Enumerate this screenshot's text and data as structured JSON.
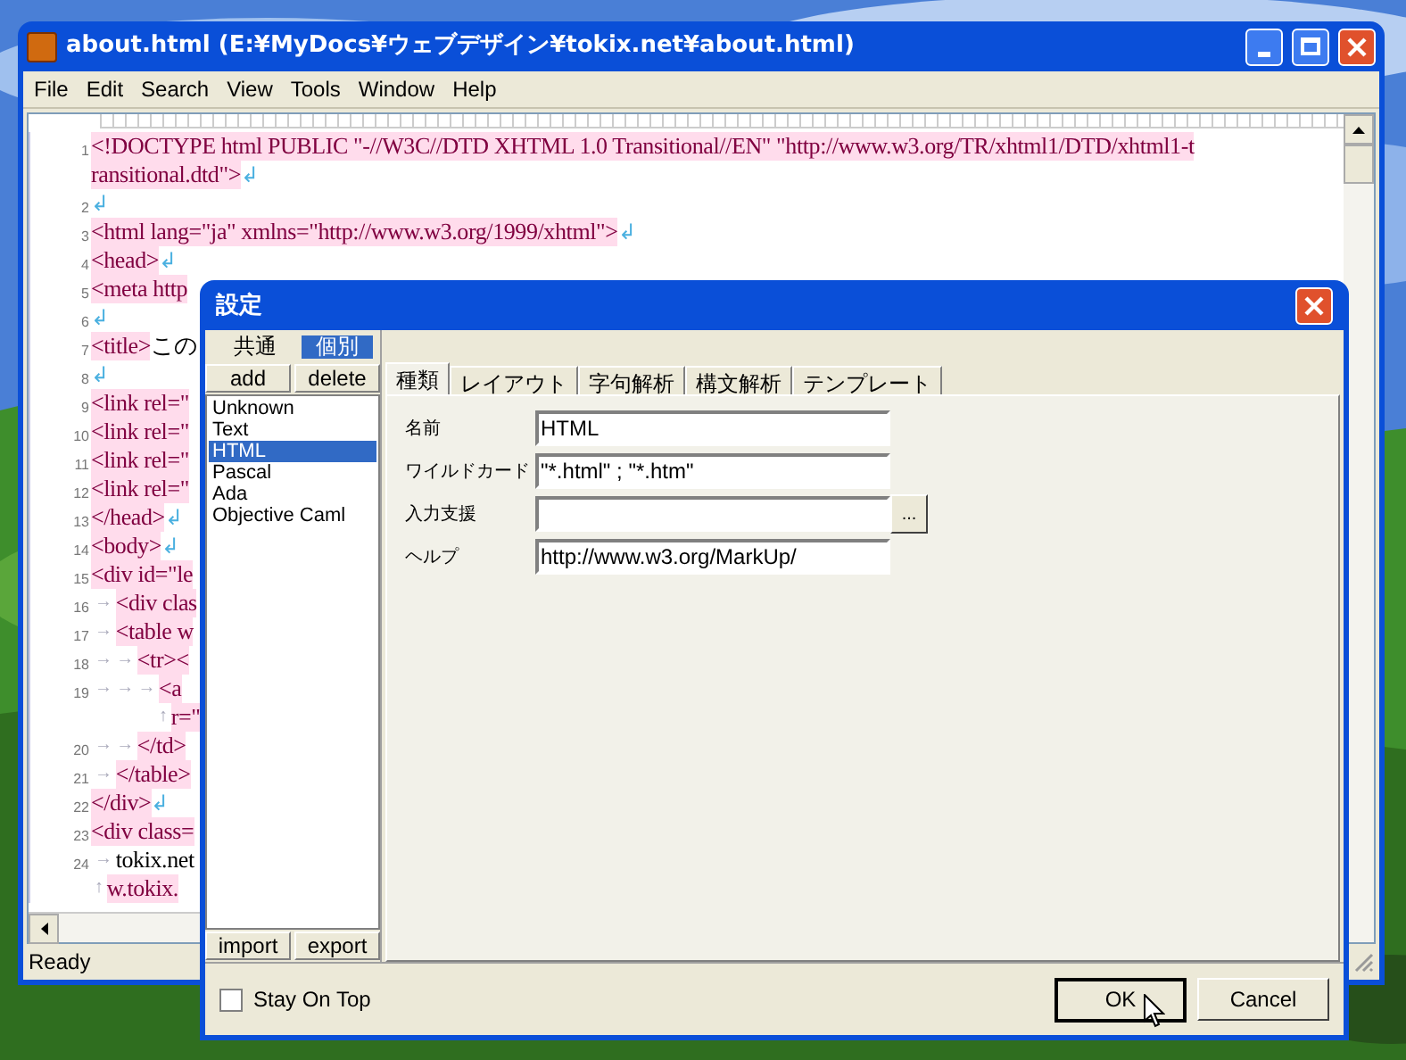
{
  "editor": {
    "title": "about.html (E:¥MyDocs¥ウェブデザイン¥tokix.net¥about.html)",
    "menu": [
      "File",
      "Edit",
      "Search",
      "View",
      "Tools",
      "Window",
      "Help"
    ],
    "rows": [
      {
        "number": "1",
        "segments": [
          {
            "text": "<!DOCTYPE html PUBLIC \"-//W3C//DTD XHTML 1.0 Transitional//EN\" \"http://www.w3.org/TR/xhtml1/DTD/xhtml1-t",
            "highlight": true
          }
        ]
      },
      {
        "segments": [
          {
            "text": "ransitional.dtd\">",
            "highlight": true
          }
        ],
        "eol": "↲"
      },
      {
        "number": "2",
        "segments": [],
        "eol": "↲"
      },
      {
        "number": "3",
        "segments": [
          {
            "text": "<html lang=\"ja\" xmlns=\"http://www.w3.org/1999/xhtml\">",
            "highlight": true
          }
        ],
        "eol": "↲"
      },
      {
        "number": "4",
        "segments": [
          {
            "text": "<head>",
            "highlight": true
          }
        ],
        "eol": "↲"
      },
      {
        "number": "5",
        "segments": [
          {
            "text": "<meta http",
            "highlight": true
          }
        ]
      },
      {
        "number": "6",
        "segments": [],
        "eol": "↲"
      },
      {
        "number": "7",
        "segments": [
          {
            "text": "<title>",
            "highlight": true
          },
          {
            "text": "この",
            "highlight": false
          }
        ]
      },
      {
        "number": "8",
        "segments": [],
        "eol": "↲"
      },
      {
        "number": "9",
        "segments": [
          {
            "text": "<link rel=\"",
            "highlight": true
          }
        ]
      },
      {
        "number": "10",
        "segments": [
          {
            "text": "<link rel=\"",
            "highlight": true
          }
        ]
      },
      {
        "number": "11",
        "segments": [
          {
            "text": "<link rel=\"",
            "highlight": true
          }
        ]
      },
      {
        "number": "12",
        "segments": [
          {
            "text": "<link rel=\"",
            "highlight": true
          }
        ]
      },
      {
        "number": "13",
        "segments": [
          {
            "text": "</head>",
            "highlight": true
          }
        ],
        "eol": "↲"
      },
      {
        "number": "14",
        "segments": [
          {
            "text": "<body>",
            "highlight": true
          }
        ],
        "eol": "↲"
      },
      {
        "number": "15",
        "segments": [
          {
            "text": "<div id=\"le",
            "highlight": true
          }
        ]
      },
      {
        "number": "16",
        "prefix": "→",
        "segments": [
          {
            "text": "<div clas",
            "highlight": true
          }
        ]
      },
      {
        "number": "17",
        "prefix": "→",
        "segments": [
          {
            "text": "<table w",
            "highlight": true
          }
        ]
      },
      {
        "number": "18",
        "prefix": "→ →",
        "segments": [
          {
            "text": "<tr><",
            "highlight": true
          }
        ]
      },
      {
        "number": "19",
        "prefix": "→ → →",
        "segments": [
          {
            "text": "<a",
            "highlight": true
          }
        ]
      },
      {
        "prefix": "↑",
        "segments": [
          {
            "text": "r=\"",
            "highlight": true
          }
        ]
      },
      {
        "number": "20",
        "prefix": "→ →",
        "segments": [
          {
            "text": "</td>",
            "highlight": true
          }
        ]
      },
      {
        "number": "21",
        "prefix": "→",
        "segments": [
          {
            "text": "</table>",
            "highlight": true
          }
        ]
      },
      {
        "number": "22",
        "segments": [
          {
            "text": "</div>",
            "highlight": true
          }
        ],
        "eol": "↲"
      },
      {
        "number": "23",
        "segments": [
          {
            "text": "<div class=",
            "highlight": true
          }
        ]
      },
      {
        "number": "24",
        "prefix": "→",
        "segments": [
          {
            "text": "tokix.net",
            "highlight": false
          }
        ]
      },
      {
        "prefix": "↑",
        "segments": [
          {
            "text": "w.tokix.",
            "highlight": true
          }
        ]
      }
    ],
    "status": "Ready"
  },
  "dialog": {
    "title": "設定",
    "scope_tabs": [
      {
        "label": "共通",
        "selected": false
      },
      {
        "label": "個別",
        "selected": true
      }
    ],
    "list_buttons": [
      "add",
      "delete"
    ],
    "languages": [
      {
        "label": "Unknown",
        "selected": false
      },
      {
        "label": "Text",
        "selected": false
      },
      {
        "label": "HTML",
        "selected": true
      },
      {
        "label": "Pascal",
        "selected": false
      },
      {
        "label": "Ada",
        "selected": false
      },
      {
        "label": "Objective Caml",
        "selected": false
      }
    ],
    "io_buttons": [
      "import",
      "export"
    ],
    "tabs": [
      {
        "label": "種類",
        "selected": true
      },
      {
        "label": "レイアウト",
        "selected": false
      },
      {
        "label": "字句解析",
        "selected": false
      },
      {
        "label": "構文解析",
        "selected": false
      },
      {
        "label": "テンプレート",
        "selected": false
      }
    ],
    "fields": [
      {
        "label": "名前",
        "value": "HTML"
      },
      {
        "label": "ワイルドカード",
        "value": "\"*.html\" ; \"*.htm\""
      },
      {
        "label": "入力支援",
        "browse": "..."
      },
      {
        "label": "ヘルプ",
        "value": "http://www.w3.org/MarkUp/"
      }
    ],
    "stay_on_top": {
      "label": "Stay On Top",
      "checked": false
    },
    "ok": "OK",
    "cancel": "Cancel"
  }
}
